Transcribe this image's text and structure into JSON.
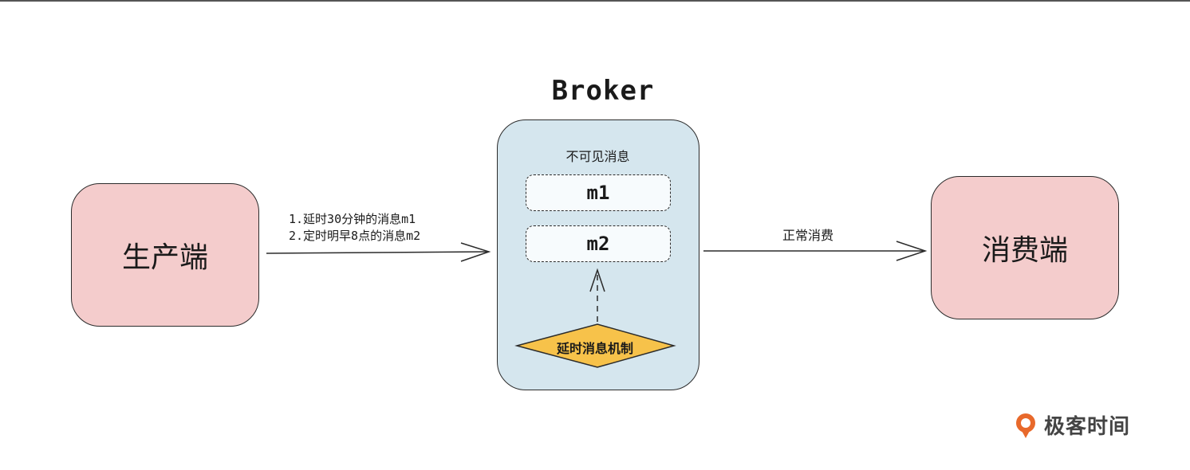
{
  "broker": {
    "title": "Broker",
    "invisible_label": "不可见消息",
    "messages": [
      "m1",
      "m2"
    ],
    "mechanism_label": "延时消息机制"
  },
  "producer": {
    "label": "生产端"
  },
  "consumer": {
    "label": "消费端"
  },
  "edges": {
    "send_lines": [
      "1.延时30分钟的消息m1",
      "2.定时明早8点的消息m2"
    ],
    "consume_label": "正常消费"
  },
  "logo": {
    "text": "极客时间"
  },
  "colors": {
    "node_fill": "#f4cccc",
    "broker_fill": "#d5e6ee",
    "mechanism_fill": "#f7c24a",
    "logo_accent": "#e8692b"
  }
}
